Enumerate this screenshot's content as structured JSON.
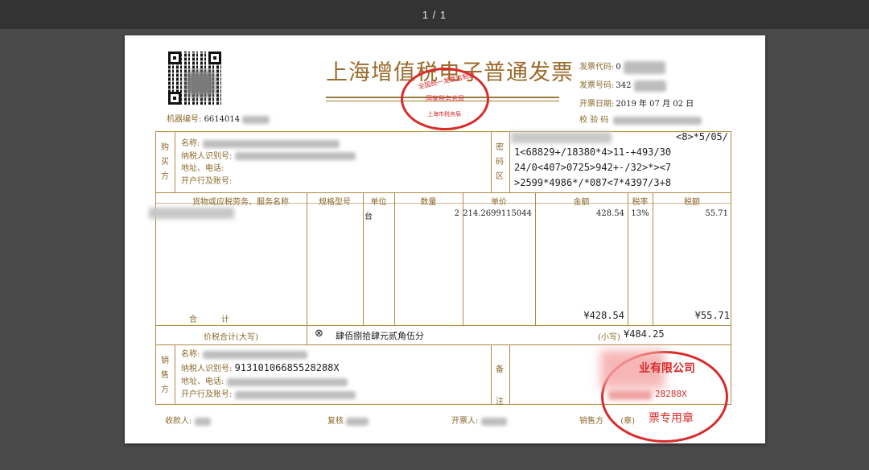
{
  "viewer": {
    "page_indicator": "1 / 1"
  },
  "invoice": {
    "title": "上海增值税电子普通发票",
    "machine_no_label": "机器编号:",
    "machine_no": "6614014",
    "meta": {
      "code_label": "发票代码:",
      "code_value": "0",
      "number_label": "发票号码:",
      "number_value": "342",
      "date_label": "开票日期:",
      "date_value": "2019 年 07 月 02 日",
      "check_label": "校 验 码",
      "check_value": ""
    },
    "buyer": {
      "section": "购买方",
      "name_label": "名称:",
      "tax_id_label": "纳税人识别号:",
      "address_label": "地址、电话:",
      "bank_label": "开户行及账号:"
    },
    "cipher": {
      "section": "密码区",
      "lines": [
        "<8>*5/05/",
        "1<68829+/18380*4>11-+493/30",
        "24/0<407>0725>942+-/32>*><7",
        ">2599*4986*/*087<7*4397/3+8"
      ]
    },
    "items": {
      "headers": {
        "name": "货物或应税劳务、服务名称",
        "spec": "规格型号",
        "unit": "单位",
        "qty": "数量",
        "price": "单价",
        "amount": "金额",
        "rate": "税率",
        "tax": "税额"
      },
      "rows": [
        {
          "unit": "台",
          "qty": "2",
          "price": "214.2699115044",
          "amount": "428.54",
          "rate": "13%",
          "tax": "55.71"
        }
      ],
      "total_label": "合　　　计",
      "total_amount": "¥428.54",
      "total_tax": "¥55.71"
    },
    "grand_total": {
      "label": "价税合计(大写)",
      "symbol": "⊗",
      "uppercase": "肆佰捌拾肆元贰角伍分",
      "lower_label": "(小写)",
      "lower_value": "¥484.25"
    },
    "seller": {
      "section": "销售方",
      "name_label": "名称:",
      "tax_id_label": "纳税人识别号:",
      "tax_id": "91310106685528288X",
      "address_label": "地址、电话:",
      "bank_label": "开户行及账号:"
    },
    "remark": {
      "section": "备注"
    },
    "footer": {
      "payee_label": "收款人:",
      "reviewer_label": "复核",
      "issuer_label": "开票人:",
      "seller_label": "销售方",
      "seller_mark": "(章)"
    },
    "stamps": {
      "tax_bureau_top": "全国统一发票监制章",
      "tax_bureau_mid": "国家税务总局",
      "tax_bureau_bottom": "上海市税务局",
      "company_top": "业有限公司",
      "company_id": "28288X",
      "company_bottom": "票专用章"
    }
  },
  "colors": {
    "frame": "#b08a45",
    "label": "#8b6a2d",
    "stamp": "#d92b2b",
    "background": "#4a4a4a"
  }
}
